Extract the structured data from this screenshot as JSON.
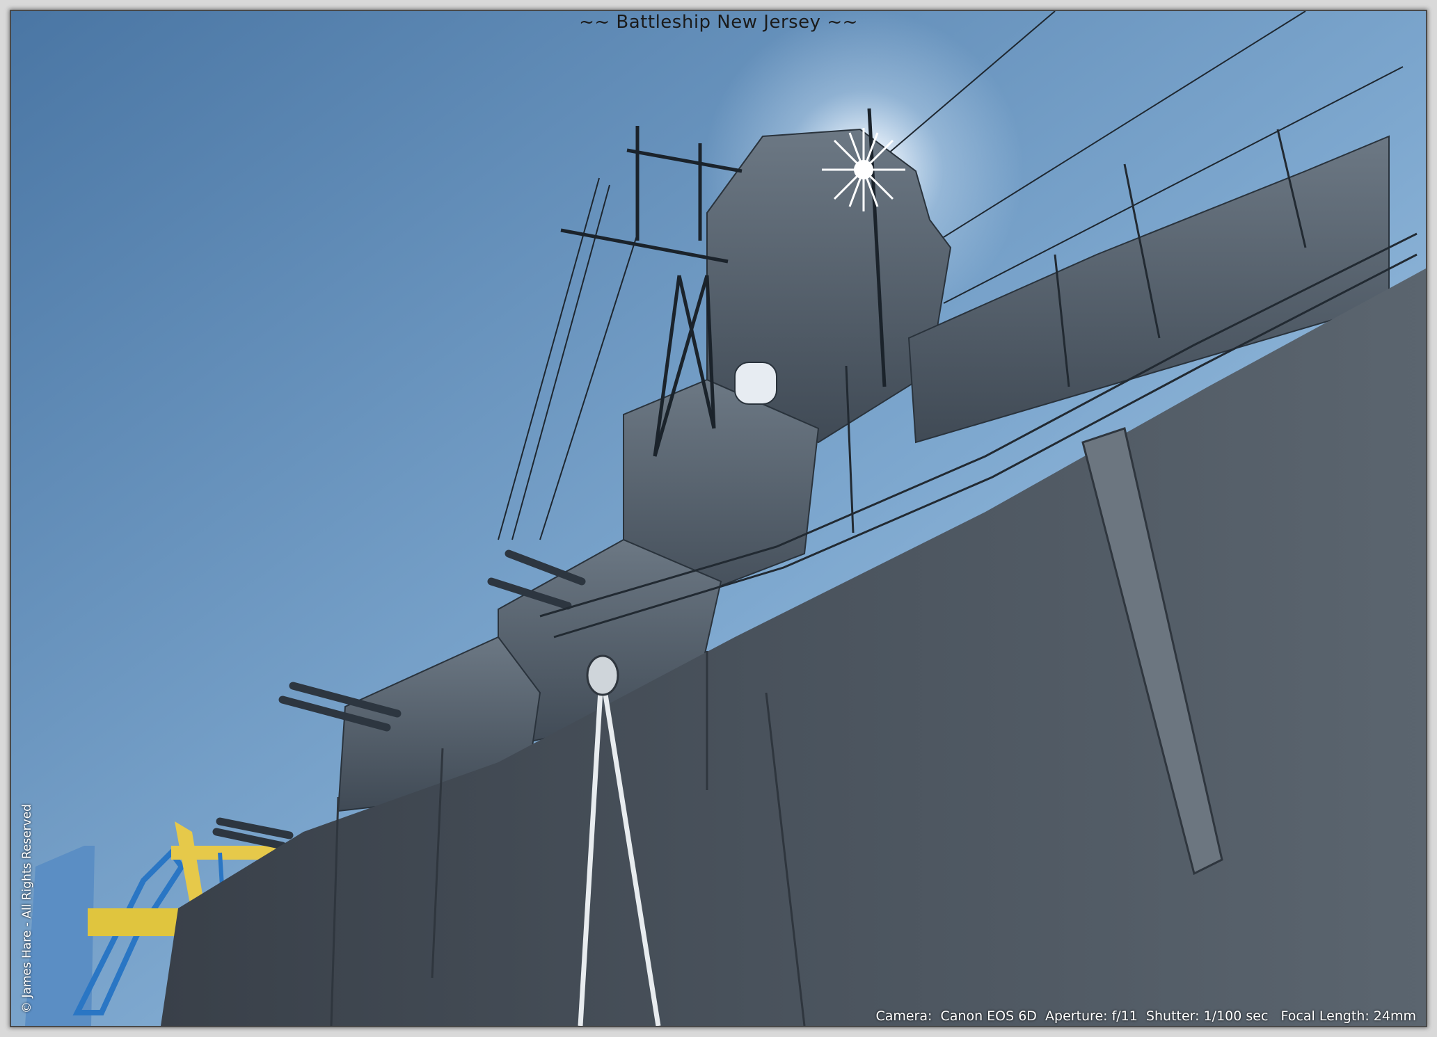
{
  "title": "~~ Battleship New Jersey ~~",
  "exif": "Camera:  Canon EOS 6D  Aperture: f/11  Shutter: 1/100 sec   Focal Length: 24mm",
  "copyright": "© James Hare - All Rights Reserved",
  "colors": {
    "sky_top": "#4b77a6",
    "sky_bottom": "#a9c9e6",
    "hull": "#3e4650",
    "hull_light": "#56606b",
    "superstructure": "#5a6672",
    "sun": "#ffffff",
    "crane": "#2a76c4",
    "crane_yellow": "#e6c94a"
  }
}
